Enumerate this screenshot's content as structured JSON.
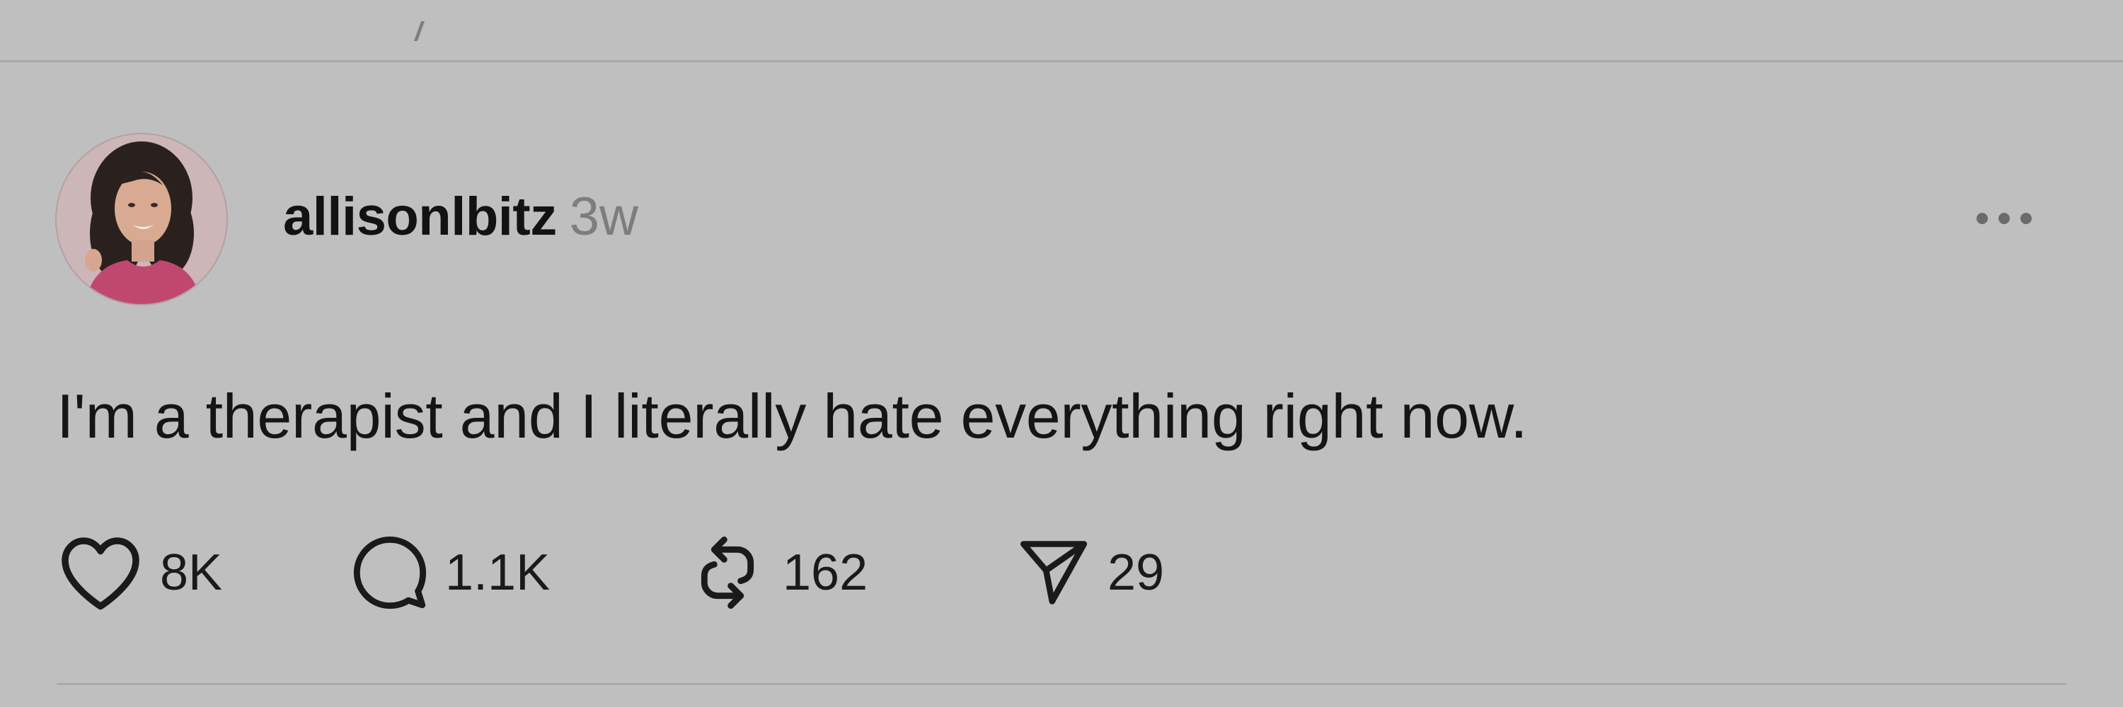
{
  "post": {
    "username": "allisonlbitz",
    "timestamp": "3w",
    "text": "I'm a therapist and I literally hate everything right now.",
    "avatar_icon": "profile-photo",
    "more_icon": "ellipsis-icon"
  },
  "actions": {
    "like": {
      "icon": "heart-icon",
      "count": "8K"
    },
    "reply": {
      "icon": "comment-icon",
      "count": "1.1K"
    },
    "repost": {
      "icon": "repost-icon",
      "count": "162"
    },
    "share": {
      "icon": "send-icon",
      "count": "29"
    }
  },
  "colors": {
    "background": "#bfbfbf",
    "text": "#141414",
    "muted": "#7d7d7d",
    "divider": "#a9a9a9"
  }
}
